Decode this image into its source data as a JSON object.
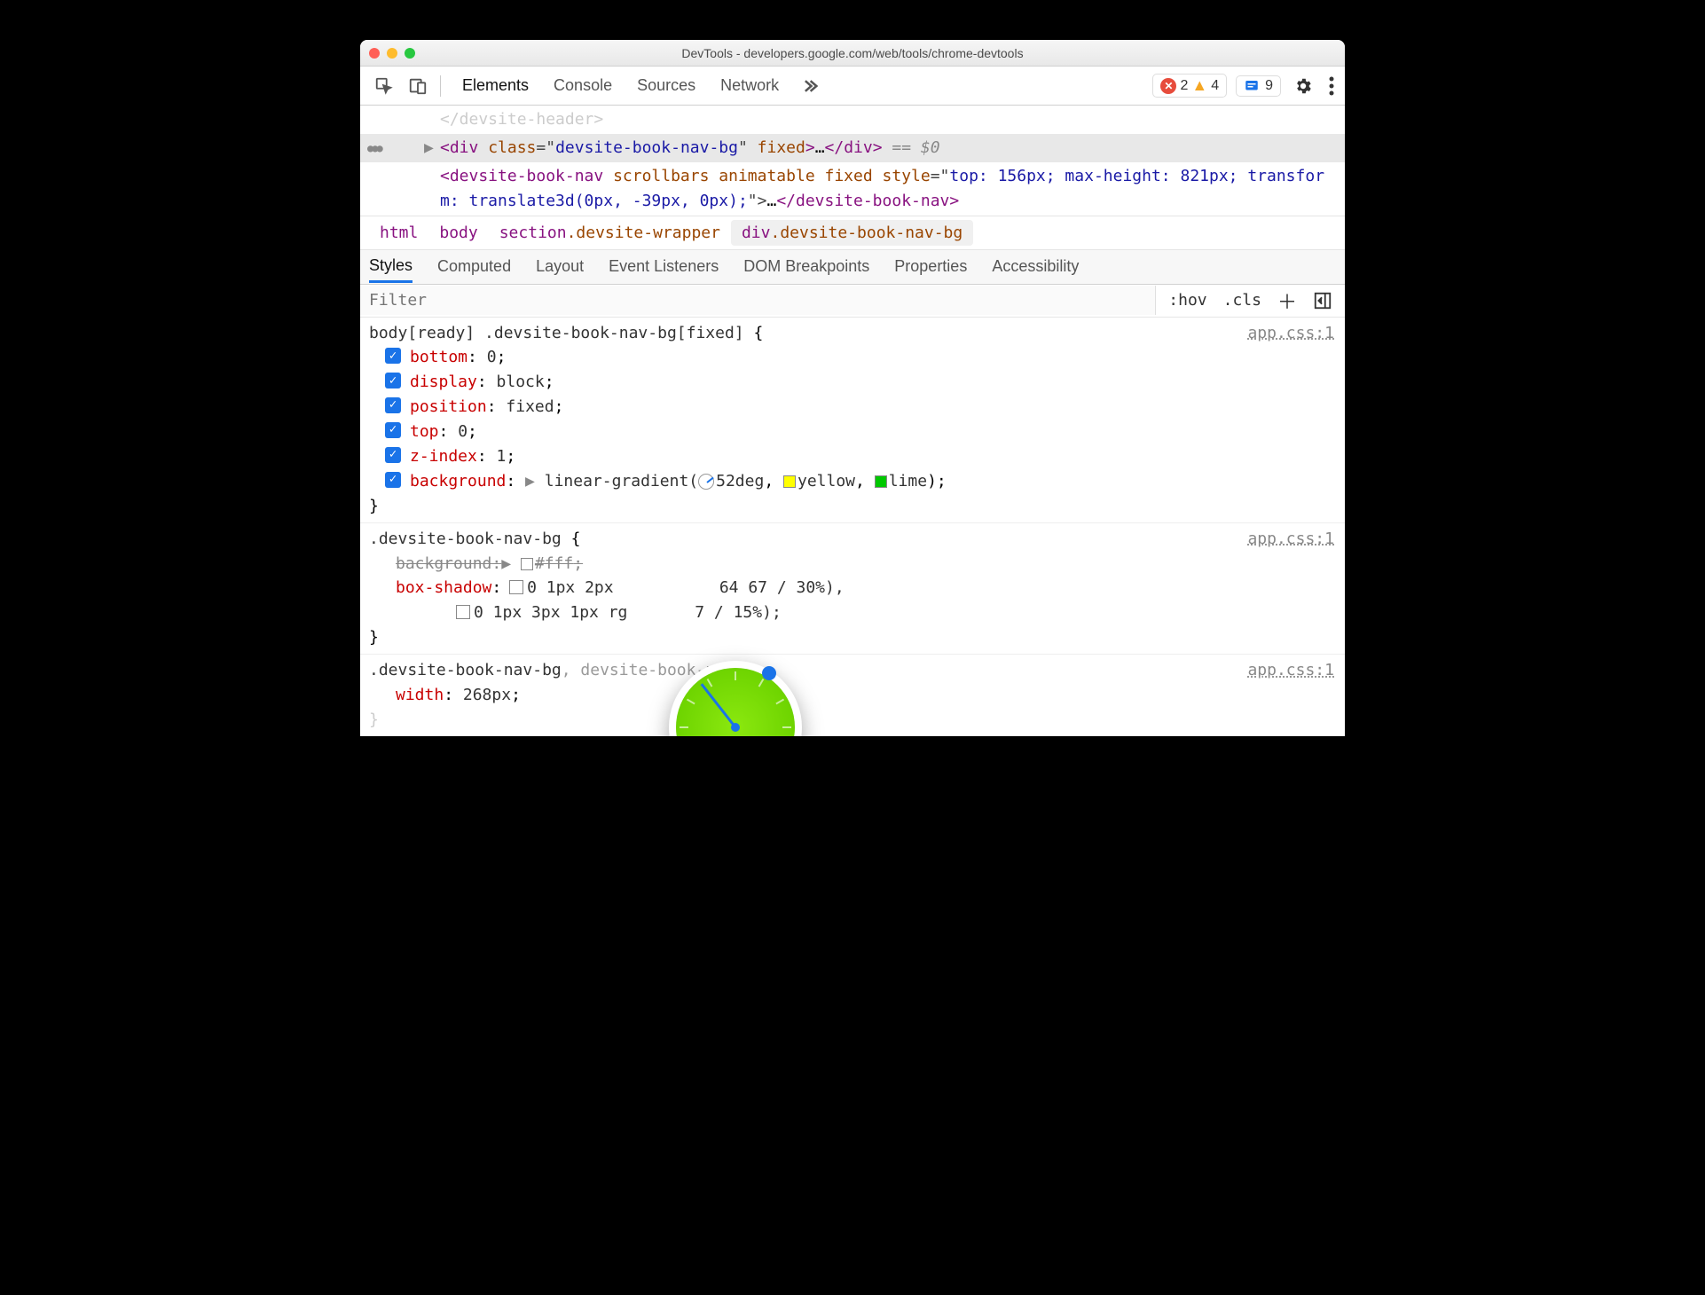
{
  "window": {
    "title": "DevTools - developers.google.com/web/tools/chrome-devtools"
  },
  "toolbar": {
    "tabs": [
      "Elements",
      "Console",
      "Sources",
      "Network"
    ],
    "active_tab": "Elements",
    "errors": 2,
    "warnings": 4,
    "issues": 9
  },
  "dom": {
    "line0_close_tag": "</devsite-header>",
    "selected": {
      "open": "<div ",
      "attr_name": "class",
      "attr_value": "devsite-book-nav-bg",
      "bool_attr": "fixed",
      "ellipsis": "…",
      "close": "</div>",
      "eq_sel": " == $0"
    },
    "line2": {
      "open_tag": "<devsite-book-nav ",
      "attrs_bool": "scrollbars animatable fixed ",
      "style_attr": "style",
      "style_val": "top: 156px; max-height: 821px; transform: translate3d(0px, -39px, 0px);",
      "ellipsis": "…",
      "close_tag": "</devsite-book-nav>"
    }
  },
  "breadcrumb": {
    "items": [
      {
        "tag": "html"
      },
      {
        "tag": "body"
      },
      {
        "tag": "section",
        "cls": ".devsite-wrapper"
      },
      {
        "tag": "div",
        "cls": ".devsite-book-nav-bg",
        "active": true
      }
    ]
  },
  "subtabs": {
    "items": [
      "Styles",
      "Computed",
      "Layout",
      "Event Listeners",
      "DOM Breakpoints",
      "Properties",
      "Accessibility"
    ],
    "active": "Styles"
  },
  "filter": {
    "placeholder": "Filter",
    "hov": ":hov",
    "cls": ".cls"
  },
  "rules": [
    {
      "selector": "body[ready] .devsite-book-nav-bg[fixed]",
      "source": "app.css:1",
      "props": [
        {
          "k": "bottom",
          "v": "0",
          "chk": true
        },
        {
          "k": "display",
          "v": "block",
          "chk": true
        },
        {
          "k": "position",
          "v": "fixed",
          "chk": true
        },
        {
          "k": "top",
          "v": "0",
          "chk": true
        },
        {
          "k": "z-index",
          "v": "1",
          "chk": true
        },
        {
          "k": "background",
          "v_prefix": "linear-gradient(",
          "angle": "52deg",
          "c1": "yellow",
          "c1_sw": "#ffff00",
          "c2": "lime",
          "c2_sw": "#00ff00",
          "v_suffix": ");",
          "chk": true,
          "expand": true
        }
      ]
    },
    {
      "selector": ".devsite-book-nav-bg",
      "source": "app.css:1",
      "props": [
        {
          "k": "background",
          "v": "#fff",
          "strike": true,
          "expand": true,
          "sw": "#ffffff"
        },
        {
          "k": "box-shadow",
          "v_a": "0 1px 2px ",
          "v_mid_hidden": "64 67 / 30%)",
          "v_b": ",",
          "line2": "0 1px 3px 1px  rg",
          "line2_tail": "7 / 15%);",
          "shadow": true
        }
      ]
    },
    {
      "selector": ".devsite-book-nav-bg",
      "selector_dim": ", devsite-book-nav",
      "source": "app.css:1",
      "props": [
        {
          "k": "width",
          "v": "268px"
        }
      ]
    }
  ],
  "angle_popup": {
    "deg": 52
  }
}
